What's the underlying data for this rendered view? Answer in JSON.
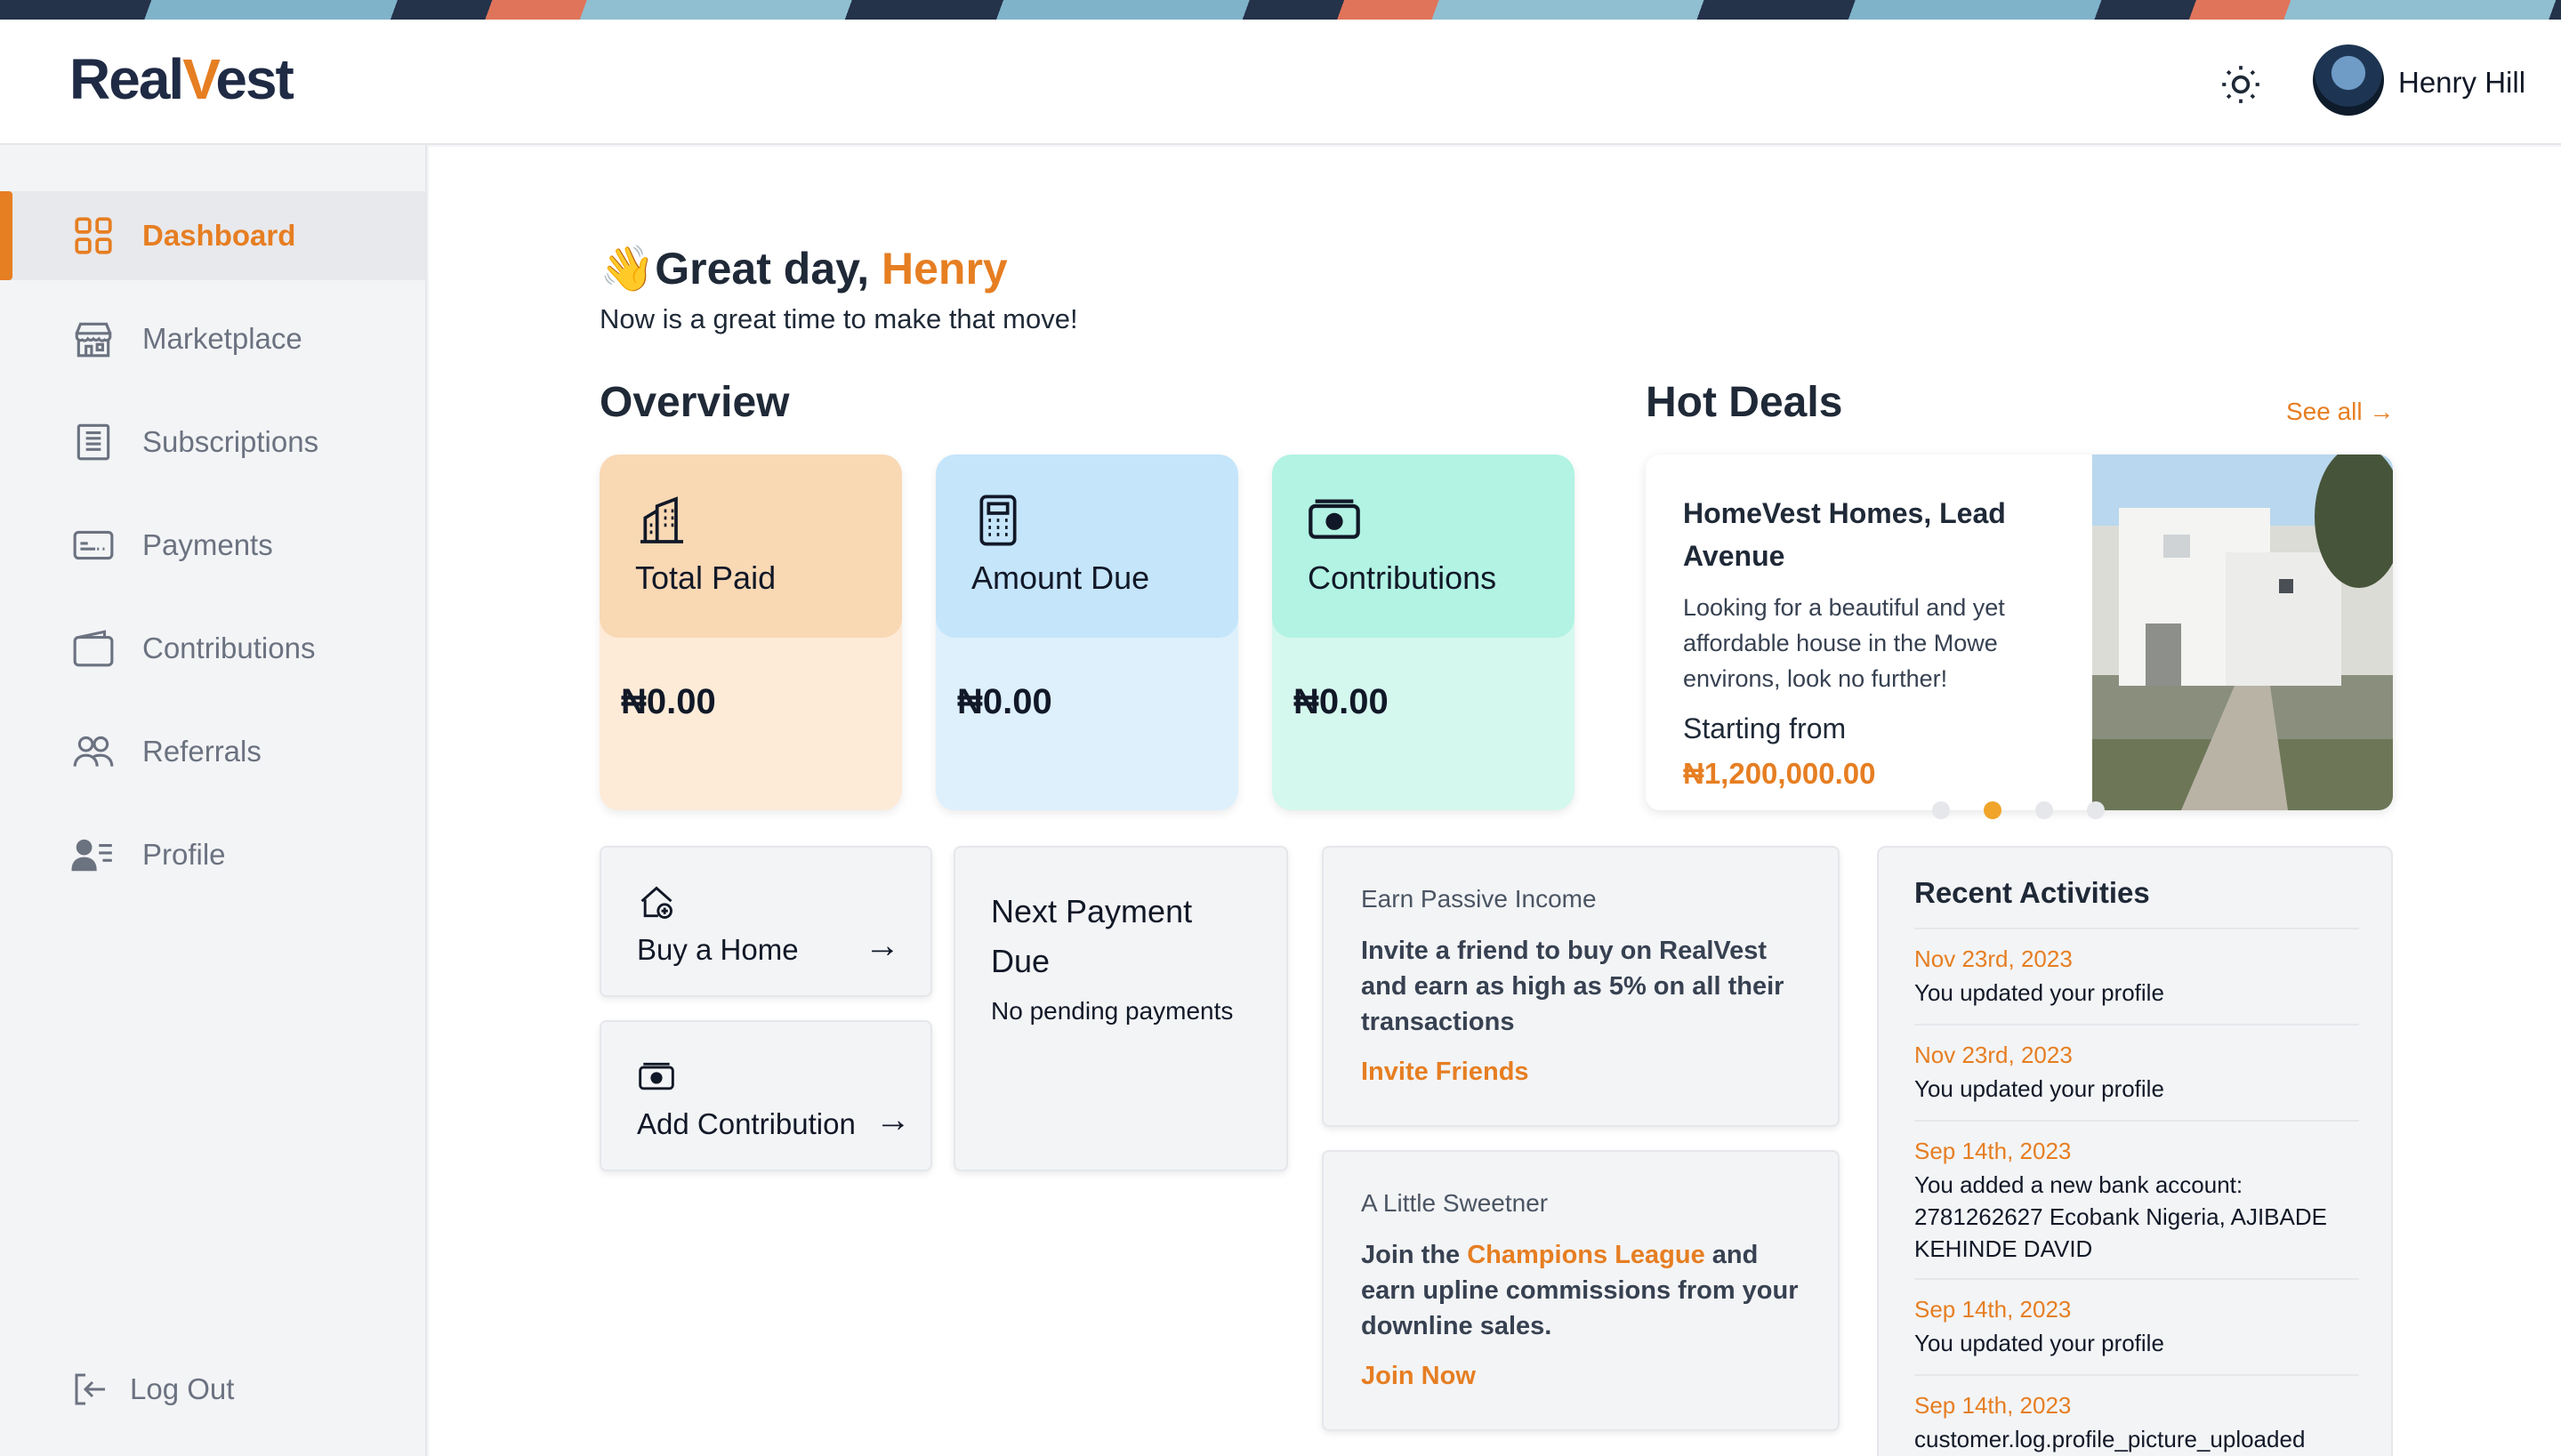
{
  "app": {
    "logo_left": "Real",
    "logo_v": "V",
    "logo_right": "est"
  },
  "header": {
    "user_name": "Henry Hill"
  },
  "sidebar": {
    "items": [
      {
        "label": "Dashboard"
      },
      {
        "label": "Marketplace"
      },
      {
        "label": "Subscriptions"
      },
      {
        "label": "Payments"
      },
      {
        "label": "Contributions"
      },
      {
        "label": "Referrals"
      },
      {
        "label": "Profile"
      }
    ],
    "logout_label": "Log Out"
  },
  "greeting": {
    "prefix": "Great day, ",
    "name": "Henry",
    "subtitle": "Now is a great time to make that move!"
  },
  "overview": {
    "title": "Overview",
    "cards": [
      {
        "label": "Total Paid",
        "amount": "₦0.00"
      },
      {
        "label": "Amount Due",
        "amount": "₦0.00"
      },
      {
        "label": "Contributions",
        "amount": "₦0.00"
      }
    ]
  },
  "hot_deals": {
    "title": "Hot Deals",
    "see_all": "See all →",
    "deal_title": "HomeVest Homes, Lead Avenue",
    "deal_desc": "Looking for a beautiful and yet affordable house in the Mowe environs, look no further!",
    "starting_label": "Starting from",
    "price": "₦1,200,000.00"
  },
  "actions": {
    "buy_home": "Buy a Home",
    "add_contribution": "Add Contribution",
    "arrow": "→",
    "next_payment_title": "Next Payment Due",
    "next_payment_status": "No pending payments"
  },
  "earn": {
    "label": "Earn Passive Income",
    "body": "Invite a friend to buy on RealVest and earn as high as 5% on all their transactions",
    "link": "Invite Friends"
  },
  "sweetener": {
    "label": "A Little Sweetner",
    "body_prefix": "Join the ",
    "highlight": "Champions League",
    "body_suffix": " and earn upline commissions from your downline sales.",
    "link": "Join Now"
  },
  "recent": {
    "title": "Recent Activities",
    "items": [
      {
        "date": "Nov 23rd, 2023",
        "message": "You updated your profile"
      },
      {
        "date": "Nov 23rd, 2023",
        "message": "You updated your profile"
      },
      {
        "date": "Sep 14th, 2023",
        "message": "You added a new bank account: 2781262627 Ecobank Nigeria, AJIBADE KEHINDE DAVID"
      },
      {
        "date": "Sep 14th, 2023",
        "message": "You updated your profile"
      },
      {
        "date": "Sep 14th, 2023",
        "message": "customer.log.profile_picture_uploaded"
      }
    ]
  },
  "colors": {
    "accent": "#e67e22",
    "card_paid": "#f9d8b4",
    "card_due": "#c5e5fb",
    "card_contrib": "#b2f3e3"
  },
  "hot_deals_carousel": {
    "active_slide": 2,
    "total_slides": 4
  }
}
